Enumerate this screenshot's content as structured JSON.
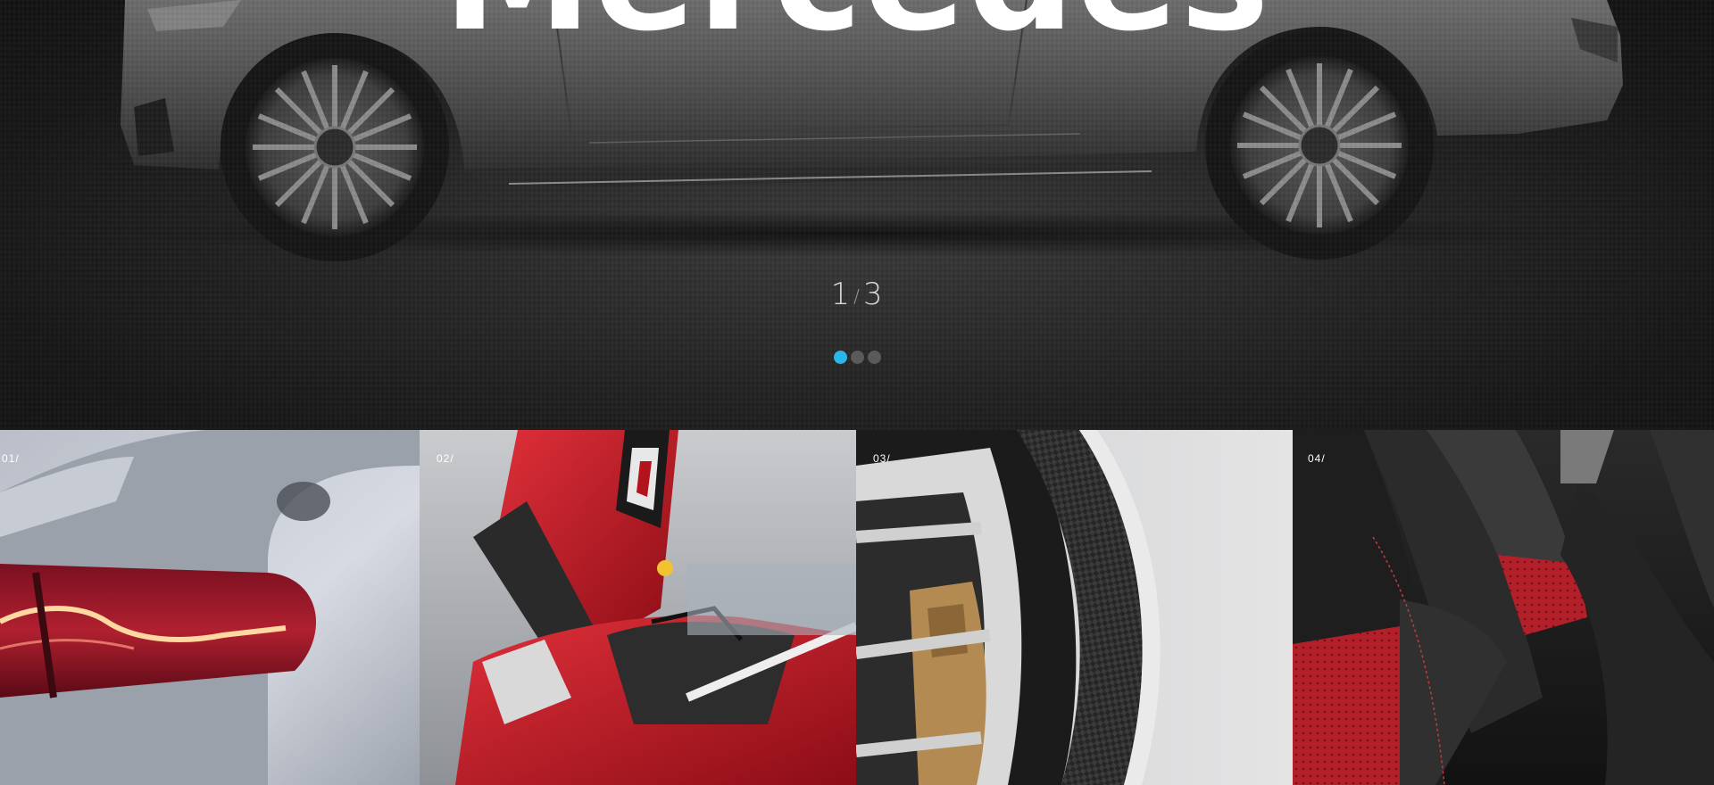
{
  "hero": {
    "title": "Mercedes",
    "counter": {
      "current": "1",
      "separator": "/",
      "total": "3"
    },
    "dots": {
      "count": 3,
      "active_index": 0,
      "active_color": "#2bb6ea",
      "inactive_color": "#5a5a5a"
    }
  },
  "tiles": [
    {
      "number": "01/",
      "subject": "tail-light"
    },
    {
      "number": "02/",
      "subject": "red-supercar-door"
    },
    {
      "number": "03/",
      "subject": "carbon-wheel-brake"
    },
    {
      "number": "04/",
      "subject": "sport-seat"
    }
  ]
}
